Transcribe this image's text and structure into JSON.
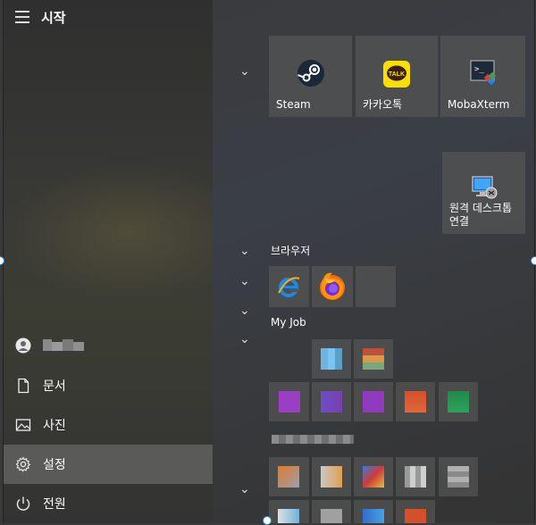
{
  "start_menu": {
    "title": "시작",
    "nav": [
      {
        "label": "",
        "icon": "user-icon"
      },
      {
        "label": "문서",
        "icon": "document-icon"
      },
      {
        "label": "사진",
        "icon": "photo-icon"
      },
      {
        "label": "설정",
        "icon": "gear-icon"
      },
      {
        "label": "전원",
        "icon": "power-icon"
      }
    ]
  },
  "tiles": {
    "steam": "Steam",
    "kakaotalk": "카카오톡",
    "kakaotalk_logo_text": "TALK",
    "mobaxterm": "MobaXterm",
    "remote_desktop": "원격 데스크톱\n연결"
  },
  "groups": {
    "browser": "브라우저",
    "myjob": "My Job"
  }
}
